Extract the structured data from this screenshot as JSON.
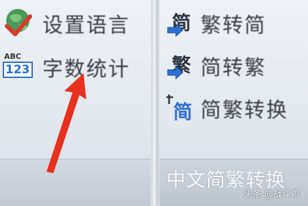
{
  "left_group": {
    "items": [
      {
        "label": "设置语言",
        "icon": "language-settings-icon"
      },
      {
        "label": "字数统计",
        "icon": "word-count-icon",
        "icon_text_top": "ABC",
        "icon_text_bottom": "123"
      }
    ]
  },
  "right_group": {
    "items": [
      {
        "label": "繁转简",
        "icon": "traditional-to-simplified-icon",
        "icon_char": "简"
      },
      {
        "label": "简转繁",
        "icon": "simplified-to-traditional-icon",
        "icon_char": "繁"
      },
      {
        "label": "简繁转换",
        "icon": "chinese-conversion-icon",
        "icon_char": "简"
      }
    ],
    "caption": "中文简繁转换"
  },
  "watermark": "头条 @战斗鸡",
  "colors": {
    "label_text": "#3a3d44",
    "annotation_arrow": "#e8301f",
    "icon_blue": "#2f6fd0"
  }
}
